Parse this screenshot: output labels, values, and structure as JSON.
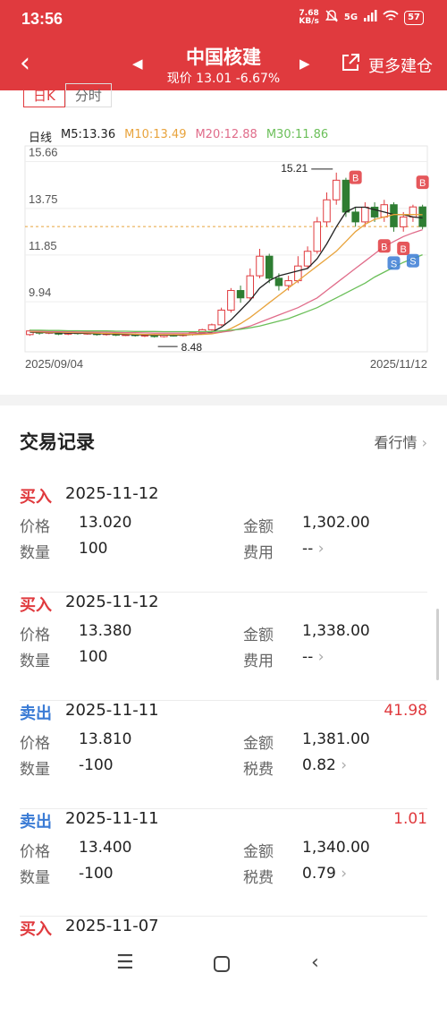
{
  "status": {
    "time": "13:56",
    "net_speed_value": "7.68",
    "net_speed_unit": "KB/s",
    "network": "5G",
    "battery": "57"
  },
  "header": {
    "title": "中国核建",
    "quote": "现价 13.01 -6.67%",
    "more_label": "更多建仓"
  },
  "tabs": [
    "日K",
    "分时"
  ],
  "legend": {
    "period": "日线",
    "m5": "M5:13.36",
    "m10": "M10:13.49",
    "m20": "M20:12.88",
    "m30": "M30:11.86"
  },
  "chart_data": {
    "type": "candlestick",
    "y_ticks": [
      "15.66",
      "13.75",
      "11.85",
      "9.94"
    ],
    "ylim": [
      7.9,
      16.3
    ],
    "x_labels": [
      "2025/09/04",
      "2025/11/12"
    ],
    "high_label": "15.21",
    "low_label": "8.48",
    "reference_price": 13.01,
    "candles": [
      [
        8.6,
        8.75,
        8.55,
        8.8
      ],
      [
        8.72,
        8.66,
        8.6,
        8.78
      ],
      [
        8.66,
        8.7,
        8.62,
        8.74
      ],
      [
        8.7,
        8.62,
        8.58,
        8.74
      ],
      [
        8.62,
        8.68,
        8.58,
        8.72
      ],
      [
        8.68,
        8.64,
        8.6,
        8.72
      ],
      [
        8.64,
        8.66,
        8.6,
        8.7
      ],
      [
        8.66,
        8.6,
        8.56,
        8.7
      ],
      [
        8.6,
        8.64,
        8.56,
        8.68
      ],
      [
        8.64,
        8.58,
        8.54,
        8.66
      ],
      [
        8.58,
        8.6,
        8.54,
        8.64
      ],
      [
        8.6,
        8.56,
        8.52,
        8.64
      ],
      [
        8.56,
        8.58,
        8.5,
        8.62
      ],
      [
        8.58,
        8.52,
        8.48,
        8.62
      ],
      [
        8.52,
        8.58,
        8.48,
        8.62
      ],
      [
        8.58,
        8.56,
        8.52,
        8.62
      ],
      [
        8.56,
        8.6,
        8.52,
        8.64
      ],
      [
        8.6,
        8.7,
        8.56,
        8.74
      ],
      [
        8.7,
        8.8,
        8.66,
        8.84
      ],
      [
        8.8,
        9.0,
        8.76,
        9.05
      ],
      [
        9.0,
        9.6,
        8.95,
        9.7
      ],
      [
        9.6,
        10.4,
        9.5,
        10.5
      ],
      [
        10.4,
        10.1,
        9.9,
        10.6
      ],
      [
        10.1,
        11.0,
        10.0,
        11.3
      ],
      [
        11.0,
        11.8,
        10.9,
        12.1
      ],
      [
        11.8,
        10.9,
        10.7,
        11.9
      ],
      [
        10.9,
        10.6,
        10.4,
        11.1
      ],
      [
        10.6,
        10.8,
        10.4,
        11.0
      ],
      [
        10.8,
        11.4,
        10.7,
        11.8
      ],
      [
        11.4,
        12.0,
        11.3,
        12.2
      ],
      [
        12.0,
        13.2,
        11.9,
        13.4
      ],
      [
        13.2,
        14.1,
        13.0,
        14.4
      ],
      [
        14.1,
        14.9,
        13.9,
        15.21
      ],
      [
        14.9,
        13.6,
        13.4,
        15.0
      ],
      [
        13.6,
        13.2,
        13.0,
        13.8
      ],
      [
        13.2,
        13.8,
        13.0,
        14.0
      ],
      [
        13.8,
        13.4,
        13.2,
        14.0
      ],
      [
        13.4,
        13.9,
        13.2,
        14.1
      ],
      [
        13.9,
        13.0,
        12.8,
        14.0
      ],
      [
        13.0,
        13.4,
        12.8,
        13.6
      ],
      [
        13.4,
        13.81,
        13.2,
        13.9
      ],
      [
        13.81,
        13.01,
        12.9,
        13.9
      ]
    ],
    "ma": {
      "M5": [
        8.7,
        8.69,
        8.68,
        8.67,
        8.66,
        8.66,
        8.65,
        8.64,
        8.63,
        8.62,
        8.61,
        8.6,
        8.59,
        8.58,
        8.58,
        8.58,
        8.58,
        8.6,
        8.64,
        8.7,
        8.9,
        9.2,
        9.6,
        10.0,
        10.5,
        10.8,
        11.0,
        11.1,
        11.2,
        11.3,
        11.7,
        12.3,
        13.0,
        13.6,
        13.8,
        13.8,
        13.7,
        13.6,
        13.5,
        13.5,
        13.4,
        13.36
      ],
      "M10": [
        8.72,
        8.71,
        8.7,
        8.7,
        8.69,
        8.68,
        8.67,
        8.66,
        8.65,
        8.64,
        8.63,
        8.62,
        8.61,
        8.6,
        8.6,
        8.6,
        8.6,
        8.6,
        8.61,
        8.63,
        8.7,
        8.85,
        9.05,
        9.3,
        9.6,
        9.9,
        10.2,
        10.5,
        10.8,
        11.1,
        11.4,
        11.7,
        12.0,
        12.4,
        12.8,
        13.1,
        13.3,
        13.4,
        13.5,
        13.5,
        13.5,
        13.49
      ],
      "M20": [
        8.75,
        8.74,
        8.73,
        8.72,
        8.72,
        8.71,
        8.71,
        8.7,
        8.7,
        8.69,
        8.68,
        8.68,
        8.67,
        8.66,
        8.66,
        8.66,
        8.66,
        8.66,
        8.66,
        8.67,
        8.7,
        8.75,
        8.85,
        8.95,
        9.1,
        9.25,
        9.4,
        9.55,
        9.7,
        9.9,
        10.1,
        10.4,
        10.7,
        11.0,
        11.3,
        11.6,
        11.9,
        12.2,
        12.4,
        12.6,
        12.75,
        12.88
      ],
      "M30": [
        8.78,
        8.78,
        8.77,
        8.77,
        8.76,
        8.76,
        8.75,
        8.75,
        8.75,
        8.74,
        8.74,
        8.73,
        8.73,
        8.73,
        8.72,
        8.72,
        8.72,
        8.72,
        8.72,
        8.73,
        8.75,
        8.78,
        8.82,
        8.88,
        8.95,
        9.05,
        9.15,
        9.25,
        9.4,
        9.55,
        9.7,
        9.9,
        10.1,
        10.3,
        10.5,
        10.7,
        10.95,
        11.15,
        11.35,
        11.55,
        11.7,
        11.86
      ]
    },
    "markers": [
      {
        "label": "B",
        "kind": "buy",
        "index": 34,
        "price": 15.0
      },
      {
        "label": "B",
        "kind": "buy",
        "index": 41,
        "price": 14.8
      },
      {
        "label": "B",
        "kind": "buy",
        "index": 37,
        "price": 12.2
      },
      {
        "label": "B",
        "kind": "buy",
        "index": 39,
        "price": 12.1
      },
      {
        "label": "S",
        "kind": "sell",
        "index": 38,
        "price": 11.5
      },
      {
        "label": "S",
        "kind": "sell",
        "index": 40,
        "price": 11.6
      }
    ]
  },
  "section": {
    "title": "交易记录",
    "link": "看行情"
  },
  "records": [
    {
      "type": "买入",
      "side": "buy",
      "date": "2025-11-12",
      "profit": "",
      "price_label": "价格",
      "price": "13.020",
      "amount_label": "金额",
      "amount": "1,302.00",
      "qty_label": "数量",
      "qty": "100",
      "fee_label": "费用",
      "fee": "--"
    },
    {
      "type": "买入",
      "side": "buy",
      "date": "2025-11-12",
      "profit": "",
      "price_label": "价格",
      "price": "13.380",
      "amount_label": "金额",
      "amount": "1,338.00",
      "qty_label": "数量",
      "qty": "100",
      "fee_label": "费用",
      "fee": "--"
    },
    {
      "type": "卖出",
      "side": "sell",
      "date": "2025-11-11",
      "profit": "41.98",
      "price_label": "价格",
      "price": "13.810",
      "amount_label": "金额",
      "amount": "1,381.00",
      "qty_label": "数量",
      "qty": "-100",
      "fee_label": "税费",
      "fee": "0.82"
    },
    {
      "type": "卖出",
      "side": "sell",
      "date": "2025-11-11",
      "profit": "1.01",
      "price_label": "价格",
      "price": "13.400",
      "amount_label": "金额",
      "amount": "1,340.00",
      "qty_label": "数量",
      "qty": "-100",
      "fee_label": "税费",
      "fee": "0.79"
    },
    {
      "type": "买入",
      "side": "buy",
      "date": "2025-11-07",
      "profit": ""
    }
  ],
  "colors": {
    "header": "#e03a3e",
    "up": "#e03a3e",
    "down": "#2e7d32",
    "buy": "#e03a3e",
    "sell": "#3a7bd5",
    "ma5": "#222222",
    "ma10": "#e8a33c",
    "ma20": "#e06c8a",
    "ma30": "#6bbf59"
  }
}
